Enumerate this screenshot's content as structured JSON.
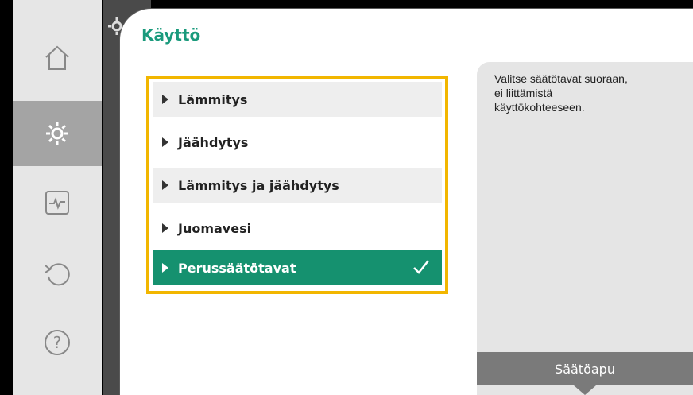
{
  "page": {
    "title": "Käyttö"
  },
  "rail": {
    "items": [
      {
        "icon": "home-icon",
        "active": false
      },
      {
        "icon": "gear-icon",
        "active": true
      },
      {
        "icon": "diagnostics-icon",
        "active": false
      },
      {
        "icon": "undo-icon",
        "active": false
      },
      {
        "icon": "help-icon",
        "active": false
      }
    ]
  },
  "menu": {
    "items": [
      {
        "label": "Lämmitys",
        "selected": false
      },
      {
        "label": "Jäähdytys",
        "selected": false
      },
      {
        "label": "Lämmitys ja jäähdytys",
        "selected": false
      },
      {
        "label": "Juomavesi",
        "selected": false
      },
      {
        "label": "Perussäätötavat",
        "selected": true
      }
    ]
  },
  "help": {
    "text": "Valitse säätötavat suoraan, ei liittämistä käyttökohteeseen.",
    "button_label": "Säätöapu"
  },
  "colors": {
    "accent": "#15916f",
    "title": "#1a9a7c",
    "focus": "#f2b600"
  }
}
